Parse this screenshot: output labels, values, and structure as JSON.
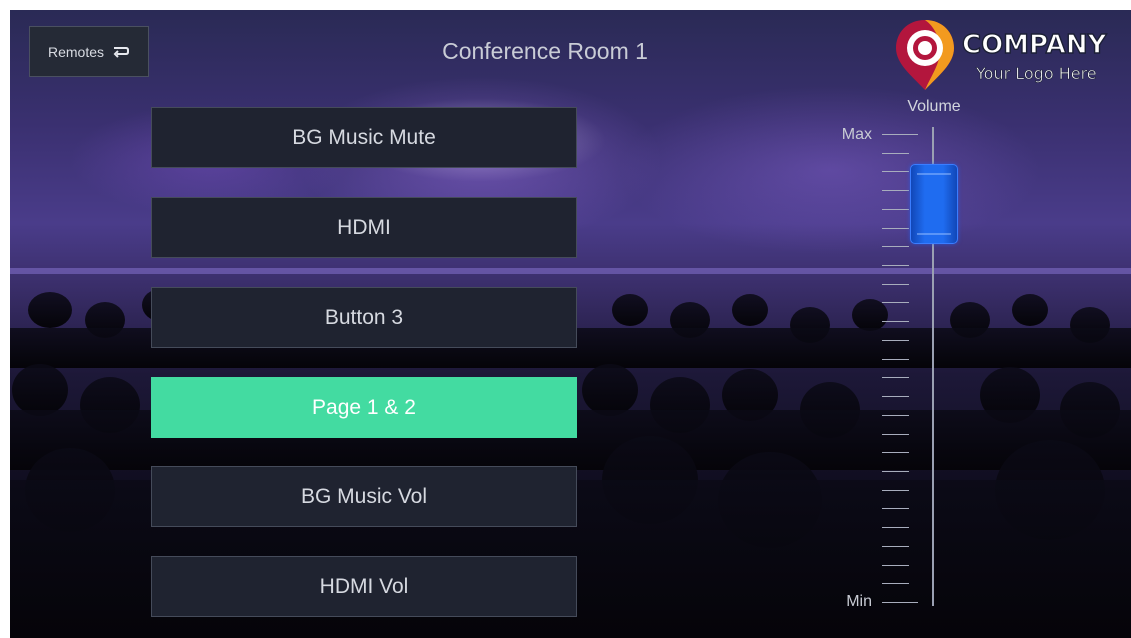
{
  "header": {
    "remotes_label": "Remotes",
    "room_title": "Conference Room 1"
  },
  "logo": {
    "word": "COMPANY",
    "tagline": "Your Logo Here"
  },
  "buttons": [
    {
      "label": "BG Music Mute",
      "active": false
    },
    {
      "label": "HDMI",
      "active": false
    },
    {
      "label": "Button 3",
      "active": false
    },
    {
      "label": "Page 1 & 2",
      "active": true
    },
    {
      "label": "BG Music Vol",
      "active": false
    },
    {
      "label": "HDMI Vol",
      "active": false
    }
  ],
  "volume": {
    "label": "Volume",
    "max_label": "Max",
    "min_label": "Min",
    "level": 0.85
  },
  "colors": {
    "accent_active": "#43dba1",
    "button_bg": "#1f2330",
    "slider_thumb": "#1f6cf0"
  }
}
